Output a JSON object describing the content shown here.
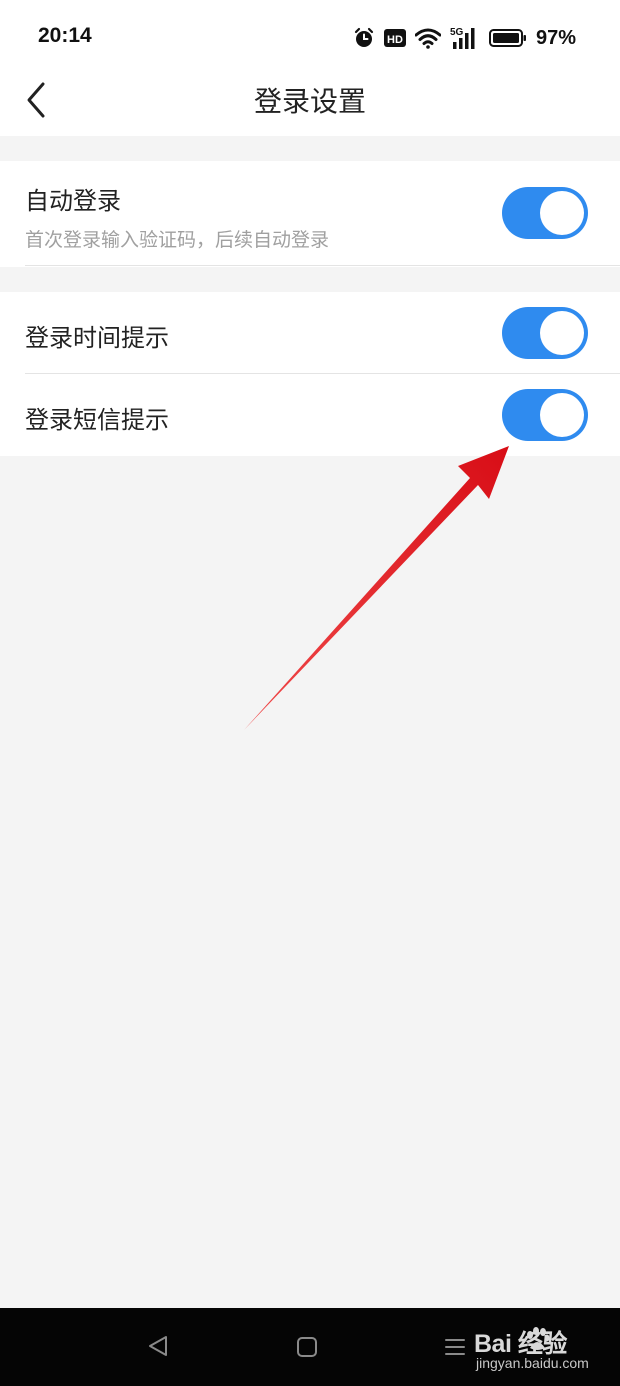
{
  "status_bar": {
    "time": "20:14",
    "hd_badge": "HD",
    "network": "5G",
    "battery": "97%"
  },
  "nav": {
    "title": "登录设置",
    "back_icon": "chevron-left-icon"
  },
  "settings": [
    {
      "label": "自动登录",
      "description": "首次登录输入验证码，后续自动登录",
      "enabled": true
    },
    {
      "label": "登录时间提示",
      "enabled": true
    },
    {
      "label": "登录短信提示",
      "enabled": true
    }
  ],
  "colors": {
    "toggle_on": "#2f8bef",
    "annotation_arrow": "#e8141e",
    "background": "#f4f4f4"
  },
  "system_nav": {
    "back": "triangle-back-icon",
    "home": "square-home-icon",
    "menu": "menu-lines-icon"
  },
  "watermark": {
    "brand": "Bai  经验",
    "url": "jingyan.baidu.com"
  }
}
